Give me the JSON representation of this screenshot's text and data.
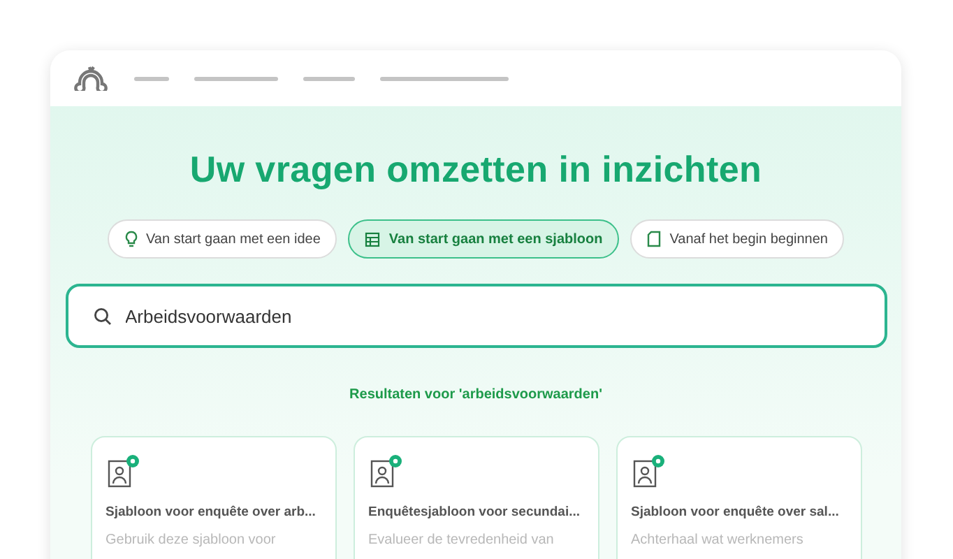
{
  "title": "Uw vragen omzetten in inzichten",
  "tabs": [
    {
      "label": "Van start gaan met een idee",
      "selected": false,
      "kind": "idea"
    },
    {
      "label": "Van start gaan met een sjabloon",
      "selected": true,
      "kind": "template"
    },
    {
      "label": "Vanaf het begin beginnen",
      "selected": false,
      "kind": "blank"
    }
  ],
  "search": {
    "value": "Arbeidsvoorwaarden"
  },
  "results_label": "Resultaten voor 'arbeidsvoorwaarden'",
  "cards": [
    {
      "title": "Sjabloon voor enquête over arb...",
      "description": "Gebruik deze sjabloon voor"
    },
    {
      "title": "Enquêtesjabloon voor secundai...",
      "description": "Evalueer de tevredenheid van"
    },
    {
      "title": "Sjabloon voor enquête over sal...",
      "description": "Achterhaal wat werknemers"
    }
  ]
}
